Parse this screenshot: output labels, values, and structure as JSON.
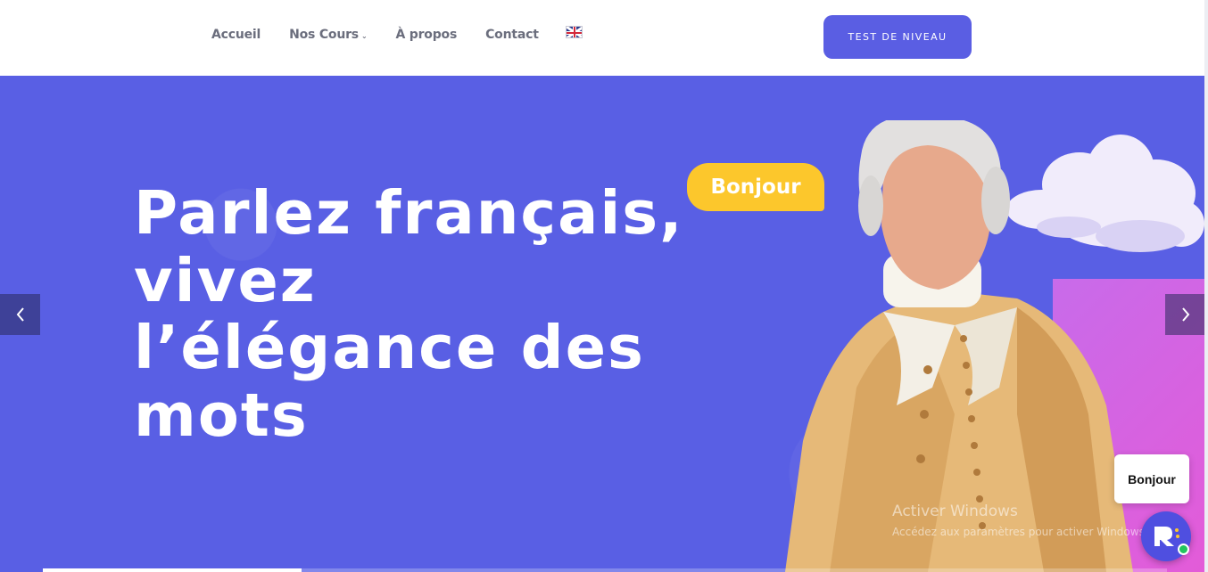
{
  "nav": {
    "items": [
      {
        "label": "Accueil"
      },
      {
        "label": "Nos Cours",
        "dropdown": true
      },
      {
        "label": "À propos"
      },
      {
        "label": "Contact"
      }
    ],
    "language_icon": "uk-flag-icon",
    "cta_label": "TEST DE NIVEAU"
  },
  "hero": {
    "title_lines": [
      "Parlez français,",
      "vivez",
      "l’élégance des",
      "mots"
    ],
    "bubble_text": "Bonjour",
    "prev_icon": "chevron-left-icon",
    "next_icon": "chevron-right-icon",
    "slide_progress": 0.23
  },
  "os_watermark": {
    "line1": "Activer Windows",
    "line2": "Accédez aux paramètres pour activer Windows."
  },
  "chat": {
    "greeting": "Bonjour",
    "launcher_icon": "chat-logo-icon",
    "online": true
  },
  "colors": {
    "brand": "#595fe4",
    "button": "#5a5ee3",
    "accent_yellow": "#fcc72c",
    "accent_pink": "#e35bd8",
    "nav_text": "#6b6e7d",
    "status_online": "#22c55e"
  }
}
